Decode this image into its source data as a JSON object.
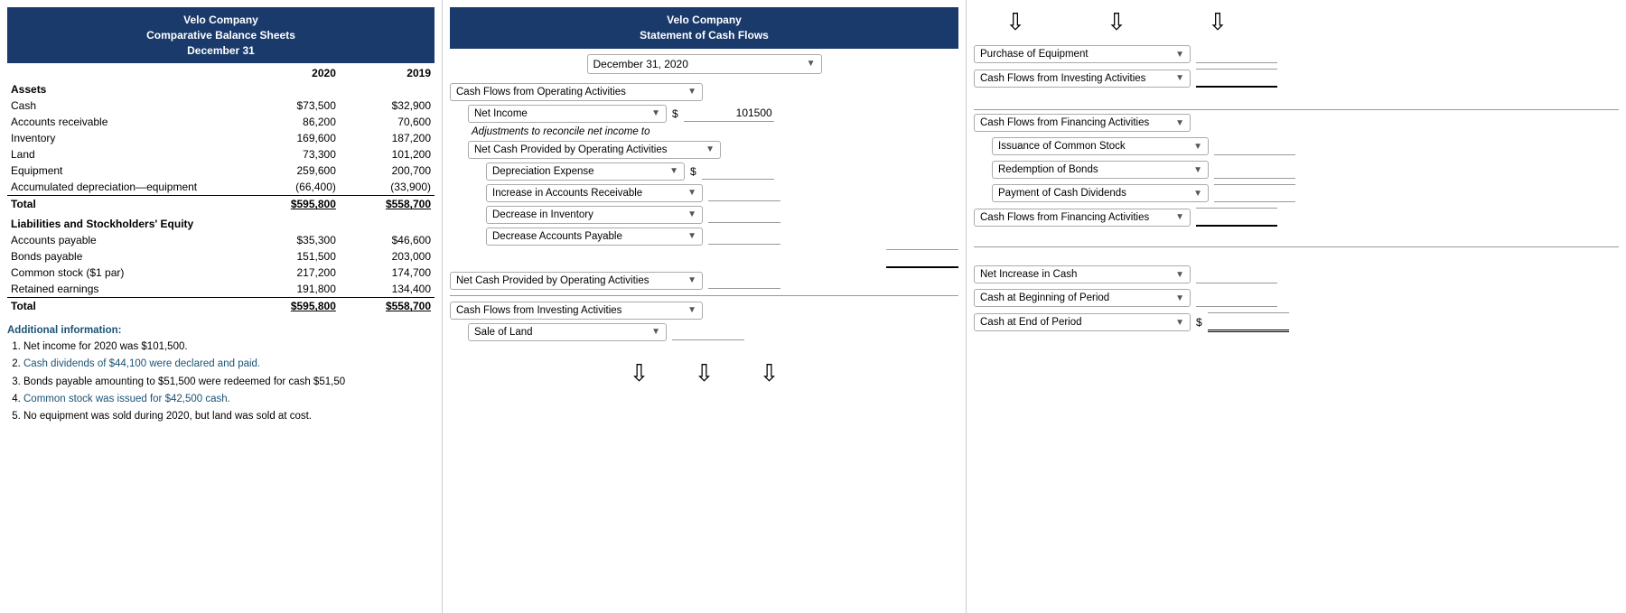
{
  "leftPanel": {
    "title": "Velo Company",
    "subtitle": "Comparative Balance Sheets",
    "subtitle2": "December 31",
    "headers": [
      "",
      "2020",
      "2019"
    ],
    "assetsLabel": "Assets",
    "assets": [
      {
        "label": "Cash",
        "val2020": "$73,500",
        "val2019": "$32,900"
      },
      {
        "label": "Accounts receivable",
        "val2020": "86,200",
        "val2019": "70,600"
      },
      {
        "label": "Inventory",
        "val2020": "169,600",
        "val2019": "187,200"
      },
      {
        "label": "Land",
        "val2020": "73,300",
        "val2019": "101,200"
      },
      {
        "label": "Equipment",
        "val2020": "259,600",
        "val2019": "200,700"
      },
      {
        "label": "Accumulated depreciation—equipment",
        "val2020": "(66,400)",
        "val2019": "(33,900)"
      },
      {
        "label": "Total",
        "val2020": "$595,800",
        "val2019": "$558,700",
        "isTotal": true
      }
    ],
    "liabEquityLabel": "Liabilities and Stockholders' Equity",
    "liabEquity": [
      {
        "label": "Accounts payable",
        "val2020": "$35,300",
        "val2019": "$46,600"
      },
      {
        "label": "Bonds payable",
        "val2020": "151,500",
        "val2019": "203,000"
      },
      {
        "label": "Common stock ($1 par)",
        "val2020": "217,200",
        "val2019": "174,700"
      },
      {
        "label": "Retained earnings",
        "val2020": "191,800",
        "val2019": "134,400"
      },
      {
        "label": "Total",
        "val2020": "$595,800",
        "val2019": "$558,700",
        "isTotal": true
      }
    ],
    "additionalInfoTitle": "Additional information:",
    "additionalInfo": [
      "Net income for 2020 was $101,500.",
      "Cash dividends of $44,100 were declared and paid.",
      "Bonds payable amounting to $51,500 were redeemed for cash $51,50",
      "Common stock was issued for $42,500 cash.",
      "No equipment was sold during 2020, but land was sold at cost."
    ]
  },
  "middlePanel": {
    "companyTitle": "Velo Company",
    "statementTitle": "Statement of Cash Flows",
    "dateLabel": "December 31, 2020",
    "sections": {
      "operating": {
        "dropdown": "Cash Flows from Operating Activities",
        "netIncomeDropdown": "Net Income",
        "netIncomeValue": "101500",
        "adjText": "Adjustments to reconcile net income to",
        "netCashDropdown": "Net Cash Provided by Operating Activities",
        "items": [
          {
            "dropdown": "Depreciation Expense",
            "hasDollar": true,
            "value": ""
          },
          {
            "dropdown": "Increase in Accounts Receivable",
            "value": ""
          },
          {
            "dropdown": "Decrease in Inventory",
            "value": ""
          },
          {
            "dropdown": "Decrease Accounts Payable",
            "value": ""
          }
        ],
        "subtotalDropdown": "Net Cash Provided by Operating Activities"
      },
      "investing": {
        "dropdown": "Cash Flows from Investing Activities",
        "items": [
          {
            "dropdown": "Sale of Land",
            "value": ""
          }
        ]
      }
    },
    "downArrows": [
      "⇩",
      "⇩",
      "⇩"
    ]
  },
  "rightPanel": {
    "topArrows": [
      "⇩",
      "⇩",
      "⇩"
    ],
    "investingSection": {
      "items": [
        {
          "dropdown": "Purchase of Equipment",
          "value": ""
        },
        {
          "dropdown": "Cash Flows from Investing Activities",
          "value": ""
        }
      ]
    },
    "financingSection": {
      "headerDropdown": "Cash Flows from Financing Activities",
      "items": [
        {
          "dropdown": "Issuance of Common Stock",
          "value": ""
        },
        {
          "dropdown": "Redemption of Bonds",
          "value": ""
        },
        {
          "dropdown": "Payment of Cash Dividends",
          "value": ""
        },
        {
          "dropdown": "Cash Flows from Financing Activities",
          "value": ""
        }
      ]
    },
    "summarySection": {
      "items": [
        {
          "dropdown": "Net Increase in Cash",
          "value": ""
        },
        {
          "dropdown": "Cash at Beginning of Period",
          "value": ""
        },
        {
          "dropdown": "Cash at End of Period",
          "hasDollarPrefix": true,
          "value": ""
        }
      ]
    }
  }
}
